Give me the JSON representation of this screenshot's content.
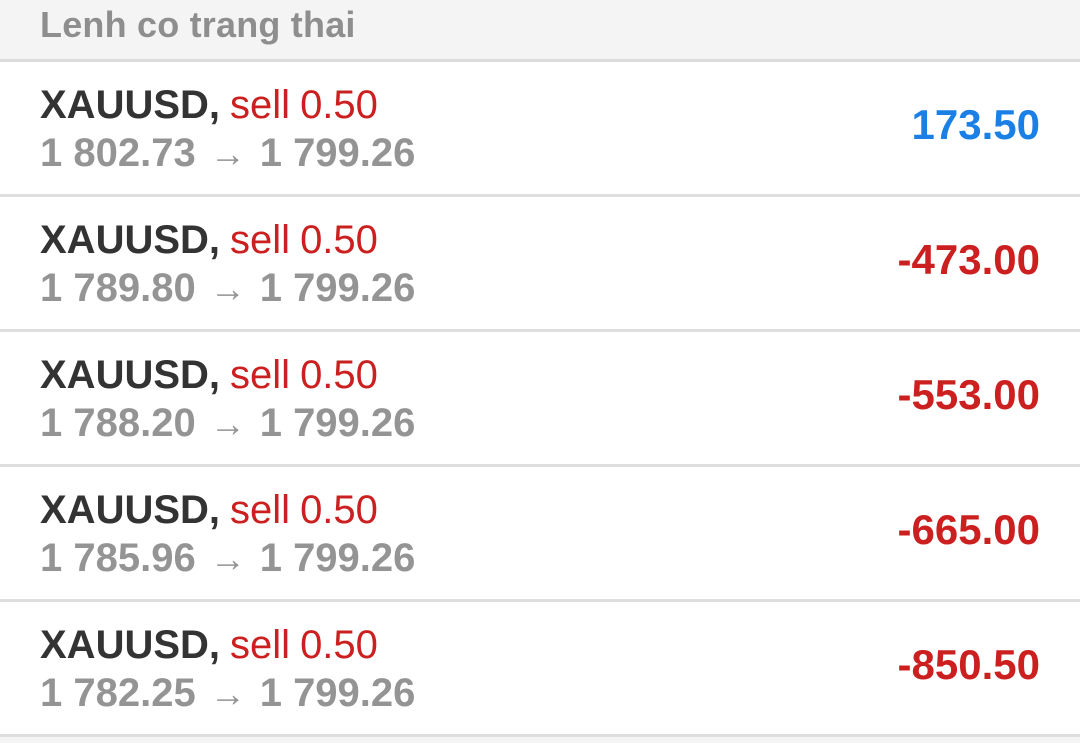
{
  "header": {
    "title": "Lenh co trang thai"
  },
  "colors": {
    "profit_positive": "#1a80e6",
    "profit_negative": "#cc1f1f",
    "sell": "#cc1f1f"
  },
  "arrow": "→",
  "orders": [
    {
      "symbol": "XAUUSD",
      "side": "sell",
      "volume": "0.50",
      "open_price": "1 802.73",
      "current_price": "1 799.26",
      "profit": "173.50",
      "direction": "pos"
    },
    {
      "symbol": "XAUUSD",
      "side": "sell",
      "volume": "0.50",
      "open_price": "1 789.80",
      "current_price": "1 799.26",
      "profit": "-473.00",
      "direction": "neg"
    },
    {
      "symbol": "XAUUSD",
      "side": "sell",
      "volume": "0.50",
      "open_price": "1 788.20",
      "current_price": "1 799.26",
      "profit": "-553.00",
      "direction": "neg"
    },
    {
      "symbol": "XAUUSD",
      "side": "sell",
      "volume": "0.50",
      "open_price": "1 785.96",
      "current_price": "1 799.26",
      "profit": "-665.00",
      "direction": "neg"
    },
    {
      "symbol": "XAUUSD",
      "side": "sell",
      "volume": "0.50",
      "open_price": "1 782.25",
      "current_price": "1 799.26",
      "profit": "-850.50",
      "direction": "neg"
    }
  ]
}
